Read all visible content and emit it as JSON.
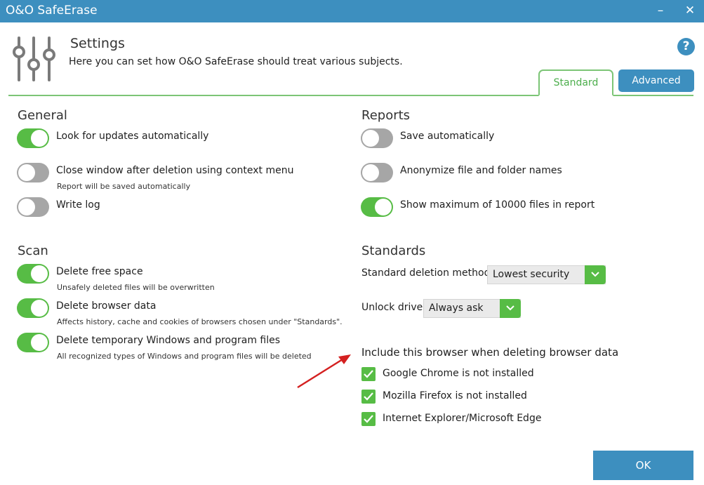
{
  "window": {
    "title": "O&O SafeErase",
    "minimize_glyph": "–",
    "close_glyph": "✕"
  },
  "header": {
    "icon": "settings-sliders-icon",
    "title": "Settings",
    "subtitle": "Here you can set how O&O SafeErase should treat various subjects.",
    "help_glyph": "?"
  },
  "tabs": [
    {
      "label": "Standard",
      "active": true
    },
    {
      "label": "Advanced",
      "active": false
    }
  ],
  "general": {
    "heading": "General",
    "items": [
      {
        "label": "Look for updates automatically",
        "on": true,
        "sub": ""
      },
      {
        "label": "Close window after deletion using context menu",
        "on": false,
        "sub": "Report will be saved automatically"
      },
      {
        "label": "Write log",
        "on": false,
        "sub": ""
      }
    ]
  },
  "scan": {
    "heading": "Scan",
    "items": [
      {
        "label": "Delete free space",
        "on": true,
        "sub": "Unsafely deleted files will be overwritten"
      },
      {
        "label": "Delete browser data",
        "on": true,
        "sub": "Affects history, cache and cookies of browsers chosen under \"Standards\"."
      },
      {
        "label": "Delete temporary Windows and program files",
        "on": true,
        "sub": "All recognized types of Windows and program files will be deleted"
      }
    ]
  },
  "reports": {
    "heading": "Reports",
    "items": [
      {
        "label": "Save automatically",
        "on": false
      },
      {
        "label": "Anonymize file and folder names",
        "on": false
      },
      {
        "label": "Show maximum of 10000 files in report",
        "on": true
      }
    ]
  },
  "standards": {
    "heading": "Standards",
    "deletion_method_label": "Standard deletion method",
    "deletion_method_value": "Lowest security",
    "unlock_drive_label": "Unlock drive",
    "unlock_drive_value": "Always ask",
    "browsers_heading": "Include this browser when deleting browser data",
    "browsers": [
      {
        "label": "Google Chrome is not installed",
        "checked": true
      },
      {
        "label": "Mozilla Firefox is not installed",
        "checked": true
      },
      {
        "label": "Internet Explorer/Microsoft Edge",
        "checked": true
      }
    ]
  },
  "footer": {
    "ok_label": "OK"
  },
  "colors": {
    "accent_blue": "#3d8fbf",
    "toggle_green": "#57bc45",
    "toggle_off": "#a6a6a6",
    "tab_line_green": "#7cc576",
    "annotation_red": "#d42020"
  }
}
